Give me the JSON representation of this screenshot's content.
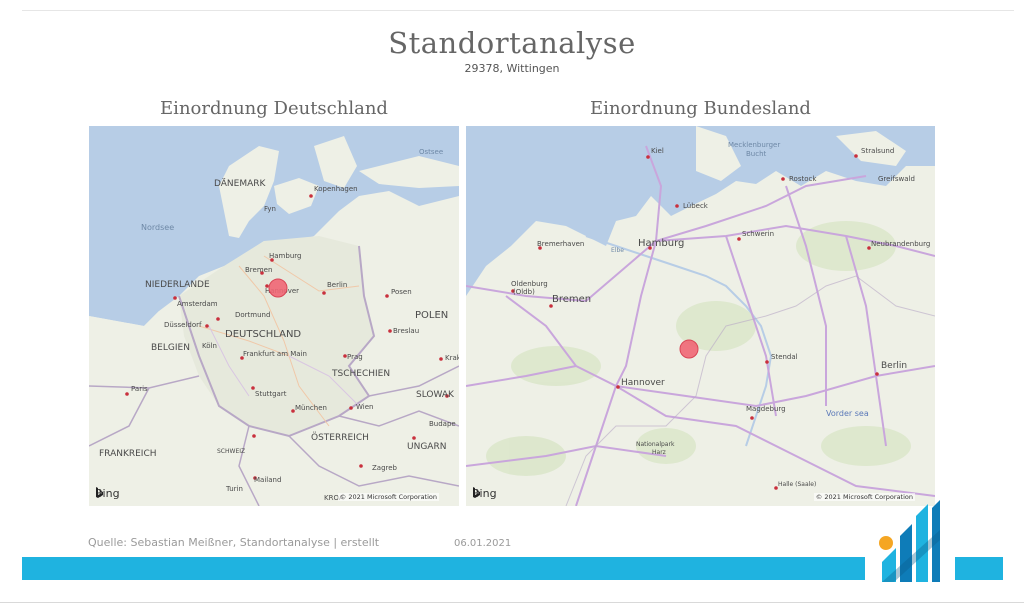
{
  "header": {
    "title": "Standortanalyse",
    "subtitle": "29378, Wittingen"
  },
  "maps": [
    {
      "title": "Einordnung Deutschland",
      "labels": {
        "ostsee": "Ostsee",
        "danemark": "DÄNEMARK",
        "kopenhagen": "Kopenhagen",
        "fyn": "Fyn",
        "nordsee": "Nordsee",
        "hamburg": "Hamburg",
        "bremen": "Bremen",
        "hannover": "Hannover",
        "berlin": "Berlin",
        "posen": "Posen",
        "niederlande": "NIEDERLANDE",
        "amsterdam": "Amsterdam",
        "dortmund": "Dortmund",
        "dusseldorf": "Düsseldorf",
        "koln": "Köln",
        "deutschland": "DEUTSCHLAND",
        "polen": "POLEN",
        "breslau": "Breslau",
        "belgien": "BELGIEN",
        "frankfurt": "Frankfurt am Main",
        "prag": "Prag",
        "tschechien": "TSCHECHIEN",
        "krak": "Krak",
        "paris": "Paris",
        "stuttgart": "Stuttgart",
        "slowak": "SLOWAK",
        "munchen": "München",
        "wien": "Wien",
        "frankreich": "FRANKREICH",
        "osterreich": "ÖSTERREICH",
        "budapest": "Budape",
        "schweiz": "SCHWEIZ",
        "ungarn": "UNGARN",
        "zagreb": "Zagreb",
        "mailand": "Mailand",
        "turin": "Turin",
        "kroa": "KROA"
      },
      "bing": "Bing",
      "copyright": "© 2021 Microsoft Corporation"
    },
    {
      "title": "Einordnung Bundesland",
      "labels": {
        "kiel": "Kiel",
        "mecklenburger": "Mecklenburger",
        "bucht": "Bucht",
        "stralsund": "Stralsund",
        "rostock": "Rostock",
        "greifswald": "Greifswald",
        "lubeck": "Lübeck",
        "schwerin": "Schwerin",
        "hamburg": "Hamburg",
        "bremerhaven": "Bremerhaven",
        "elbe": "Elbe",
        "neubrandenburg": "Neubrandenburg",
        "oldenburg1": "Oldenburg",
        "oldenburg2": "(Oldb)",
        "bremen": "Bremen",
        "stendal": "Stendal",
        "berlin": "Berlin",
        "hannover": "Hannover",
        "magdeburg": "Magdeburg",
        "vorder_see": "Vorder sea",
        "nationalpark1": "Nationalpark",
        "nationalpark2": "Harz",
        "halle": "Halle (Saale)"
      },
      "bing": "Bing",
      "copyright": "© 2021 Microsoft Corporation"
    }
  ],
  "footer": {
    "source": "Quelle: Sebastian Meißner, Standortanalyse | erstellt",
    "date": "06.01.2021"
  },
  "colors": {
    "accent_bar": "#1fb3e0",
    "marker": "#f06674",
    "water": "#b7cde6",
    "land": "#eef0e6",
    "road": "#c9a6dc"
  }
}
